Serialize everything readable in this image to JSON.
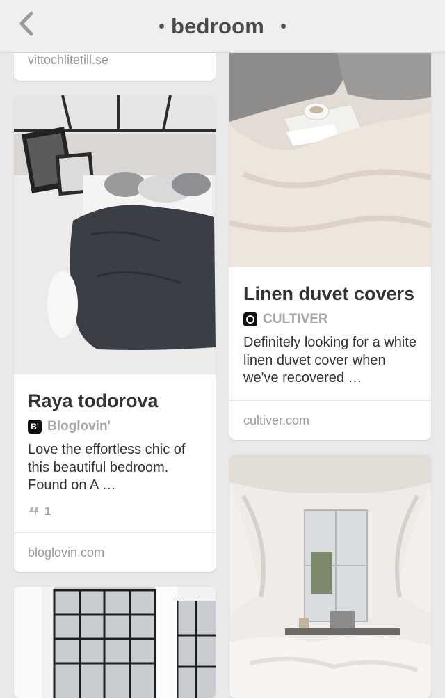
{
  "header": {
    "title": "bedroom",
    "back_icon": "chevron-left-icon"
  },
  "pins": [
    {
      "id_label": "top-left",
      "domain": "vittochlitetill.se"
    },
    {
      "id_label": "raya",
      "title": "Raya todorova",
      "source_icon_text": "B'",
      "source": "Bloglovin'",
      "description": "Love the effortless chic of this beautiful bedroom. Found on A …",
      "repin_count": "1",
      "domain": "bloglovin.com"
    },
    {
      "id_label": "linen",
      "title": "Linen duvet covers",
      "source_icon_text": "C",
      "source": "CULTIVER",
      "description": "Definitely looking for a white linen duvet cover when we've recovered …",
      "domain": "cultiver.com"
    }
  ],
  "colors": {
    "background": "#e9e9e9",
    "header": "#efefef",
    "text_primary": "#333333",
    "text_muted": "#9a9a9a"
  }
}
